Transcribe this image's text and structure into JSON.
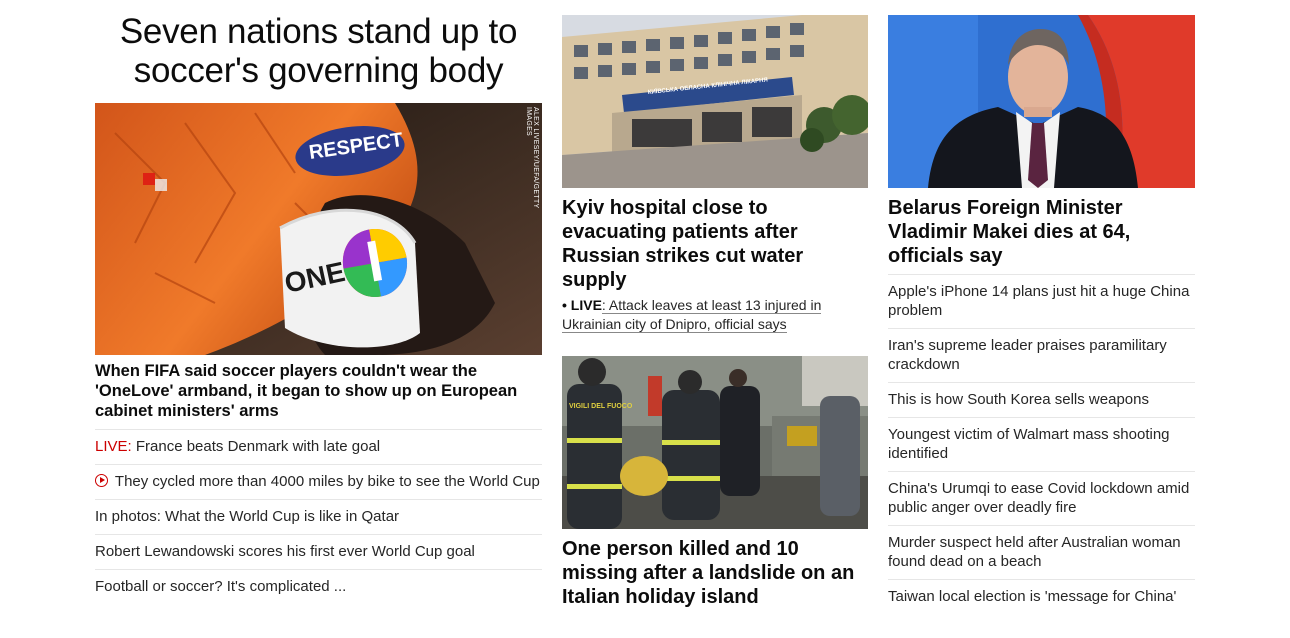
{
  "lead": {
    "headline": "Seven nations stand up to soccer's governing body",
    "image_credit": "ALEX LIVESEY/UEFA/GETTY IMAGES",
    "image_text": {
      "armband_word": "ONE",
      "sleeve_badge": "RESPECT"
    },
    "caption": "When FIFA said soccer players couldn't wear the 'OneLove' armband, it began to show up on European cabinet ministers' arms",
    "items": [
      {
        "prefix": "LIVE:",
        "text": " France beats Denmark with late goal"
      },
      {
        "icon": "play-icon",
        "text": "They cycled more than 4000 miles by bike to see the World Cup"
      },
      {
        "text": "In photos: What the World Cup is like in Qatar"
      },
      {
        "text": "Robert Lewandowski scores his first ever World Cup goal"
      },
      {
        "text": "Football or soccer? It's complicated ..."
      }
    ]
  },
  "middle": {
    "kyiv": {
      "title": "Kyiv hospital close to evacuating patients after Russian strikes cut water supply",
      "building_sign": "КИЇВСЬКА ОБЛАСНА КЛІНІЧНА ЛІКАРНЯ",
      "live_prefix": "• LIVE",
      "live_text": ": Attack leaves at least 13 injured in Ukrainian city of Dnipro, official says"
    },
    "landslide": {
      "title": "One person killed and 10 missing after a landslide on an Italian holiday island",
      "jacket_text": "VIGILI DEL FUOCO"
    }
  },
  "right": {
    "title": "Belarus Foreign Minister Vladimir Makei dies at 64, officials say",
    "items": [
      "Apple's iPhone 14 plans just hit a huge China problem",
      "Iran's supreme leader praises paramilitary crackdown",
      "This is how South Korea sells weapons",
      "Youngest victim of Walmart mass shooting identified",
      "China's Urumqi to ease Covid lockdown amid public anger over deadly fire",
      "Murder suspect held after Australian woman found dead on a beach",
      "Taiwan local election is 'message for China'"
    ]
  },
  "colors": {
    "live_red": "#cc0000",
    "text": "#0c0c0c",
    "divider": "#e6e6e6"
  }
}
